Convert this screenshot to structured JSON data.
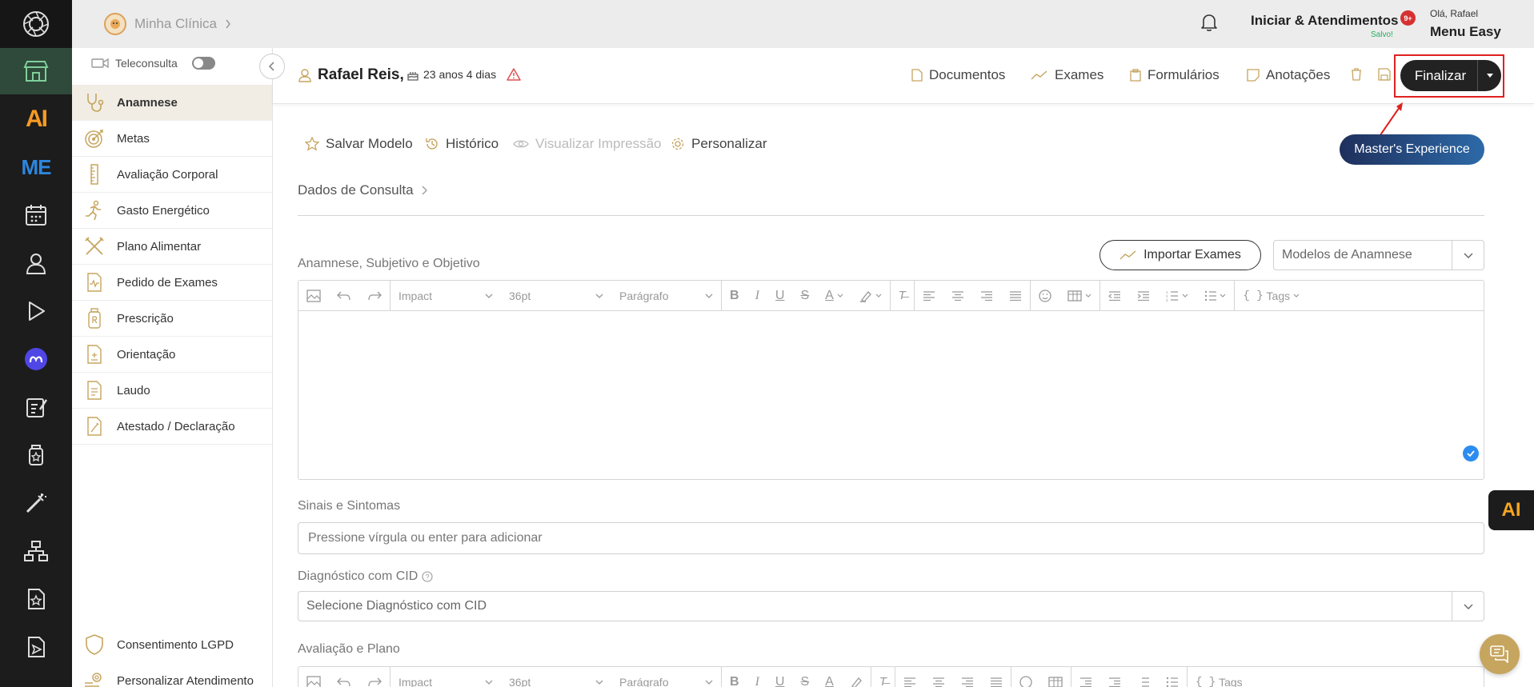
{
  "topbar": {
    "clinic_name": "Minha Clínica",
    "iniciar_label": "Iniciar & Atendimentos",
    "notif_badge": "9+",
    "saved_status": "Salvo!",
    "greeting": "Olá, Rafael",
    "menu_label": "Menu Easy"
  },
  "rail": {
    "ai_label": "AI",
    "me_label": "ME"
  },
  "sidebar": {
    "teleconsulta_label": "Teleconsulta",
    "items": [
      {
        "label": "Anamnese",
        "icon": "stethoscope-icon"
      },
      {
        "label": "Metas",
        "icon": "target-icon"
      },
      {
        "label": "Avaliação Corporal",
        "icon": "ruler-icon"
      },
      {
        "label": "Gasto Energético",
        "icon": "running-icon"
      },
      {
        "label": "Plano Alimentar",
        "icon": "utensils-icon"
      },
      {
        "label": "Pedido de Exames",
        "icon": "exam-document-icon"
      },
      {
        "label": "Prescrição",
        "icon": "bottle-icon"
      },
      {
        "label": "Orientação",
        "icon": "document-icon"
      },
      {
        "label": "Laudo",
        "icon": "report-icon"
      },
      {
        "label": "Atestado / Declaração",
        "icon": "certificate-icon"
      }
    ],
    "bottom_items": [
      {
        "label": "Consentimento LGPD",
        "icon": "shield-icon"
      },
      {
        "label": "Personalizar Atendimento",
        "icon": "customize-icon"
      }
    ]
  },
  "patient": {
    "name": "Rafael Reis,",
    "age": "23 anos 4 dias"
  },
  "header_links": {
    "documentos": "Documentos",
    "exames": "Exames",
    "formularios": "Formulários",
    "anotacoes": "Anotações",
    "finalizar": "Finalizar"
  },
  "tools": {
    "salvar_modelo": "Salvar Modelo",
    "historico": "Histórico",
    "visualizar": "Visualizar Impressão",
    "personalizar": "Personalizar",
    "master": "Master's Experience"
  },
  "form": {
    "dados_consulta": "Dados de Consulta",
    "anamnese_label": "Anamnese, Subjetivo e Objetivo",
    "importar_exames": "Importar Exames",
    "modelos_placeholder": "Modelos de Anamnese",
    "sinais_label": "Sinais e Sintomas",
    "sinais_placeholder": "Pressione vírgula ou enter para adicionar",
    "diagnostico_label": "Diagnóstico com CID",
    "diagnostico_placeholder": "Selecione Diagnóstico com CID",
    "avaliacao_label": "Avaliação e Plano"
  },
  "editor_toolbar": {
    "font": "Impact",
    "size": "36pt",
    "paragraph": "Parágrafo",
    "tags": "Tags"
  },
  "floating": {
    "ai_label": "AI"
  },
  "colors": {
    "accent_gold": "#c6a55f",
    "rail_bg": "#1c1c1c",
    "finalizar_bg": "#222222",
    "highlight_red": "#e02020"
  }
}
